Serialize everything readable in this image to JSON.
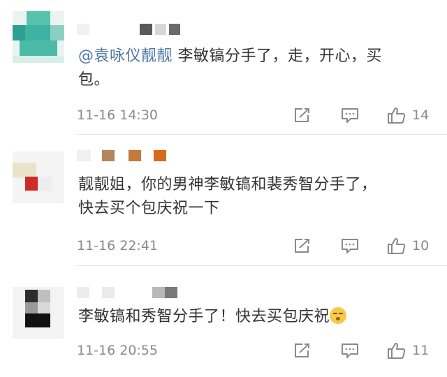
{
  "comments": [
    {
      "mention": "@袁咏仪靓靓",
      "text_line1": " 李敏镐分手了，走，开心，买",
      "text_line2": "包。",
      "time": "11-16 14:30",
      "likes": "14"
    },
    {
      "text_line1": "靓靓姐，你的男神李敏镐和裴秀智分手了，",
      "text_line2": "快去买个包庆祝一下",
      "time": "11-16 22:41",
      "likes": "10"
    },
    {
      "text_line1": "李敏镐和秀智分手了！快去买包庆祝",
      "emoji": "smirk-emoji",
      "time": "11-16 20:55",
      "likes": "11"
    }
  ],
  "icons": {
    "share": "share-icon",
    "reply": "comment-icon",
    "like": "thumbs-up-icon"
  },
  "colors": {
    "mention": "#4f77a8",
    "text": "#333333",
    "meta": "#8a8a8a"
  }
}
